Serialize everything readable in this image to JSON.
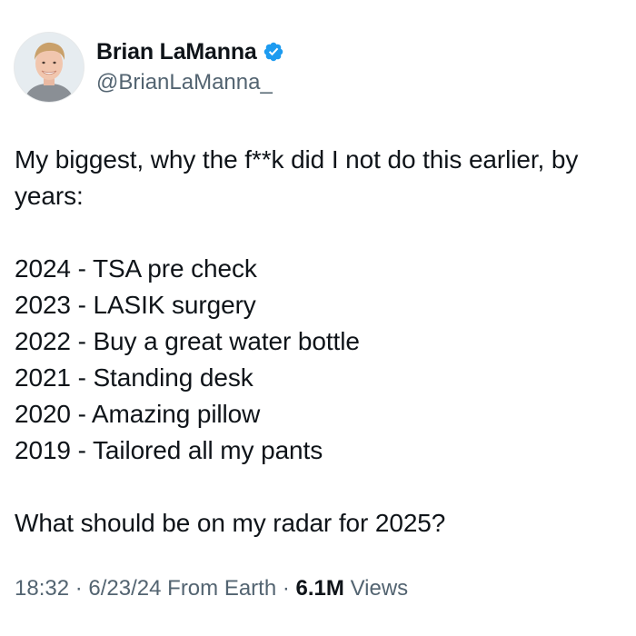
{
  "author": {
    "display_name": "Brian LaManna",
    "handle": "@BrianLaManna_",
    "verified": true,
    "avatar_icon": "profile-photo",
    "verified_icon": "verified-badge-icon",
    "verified_color": "#1d9bf0"
  },
  "tweet": {
    "intro_line": "My biggest, why the f**k did I not do this earlier, by years:",
    "list": [
      "2024 - TSA pre check",
      "2023 - LASIK surgery",
      "2022 - Buy a great water bottle",
      "2021 - Standing desk",
      "2020 - Amazing pillow",
      "2019 - Tailored all my pants"
    ],
    "question": "What should be on my radar for 2025?"
  },
  "meta": {
    "time": "18:32",
    "separator": "·",
    "date": "6/23/24",
    "source": "From Earth",
    "views_count": "6.1M",
    "views_label": "Views"
  }
}
